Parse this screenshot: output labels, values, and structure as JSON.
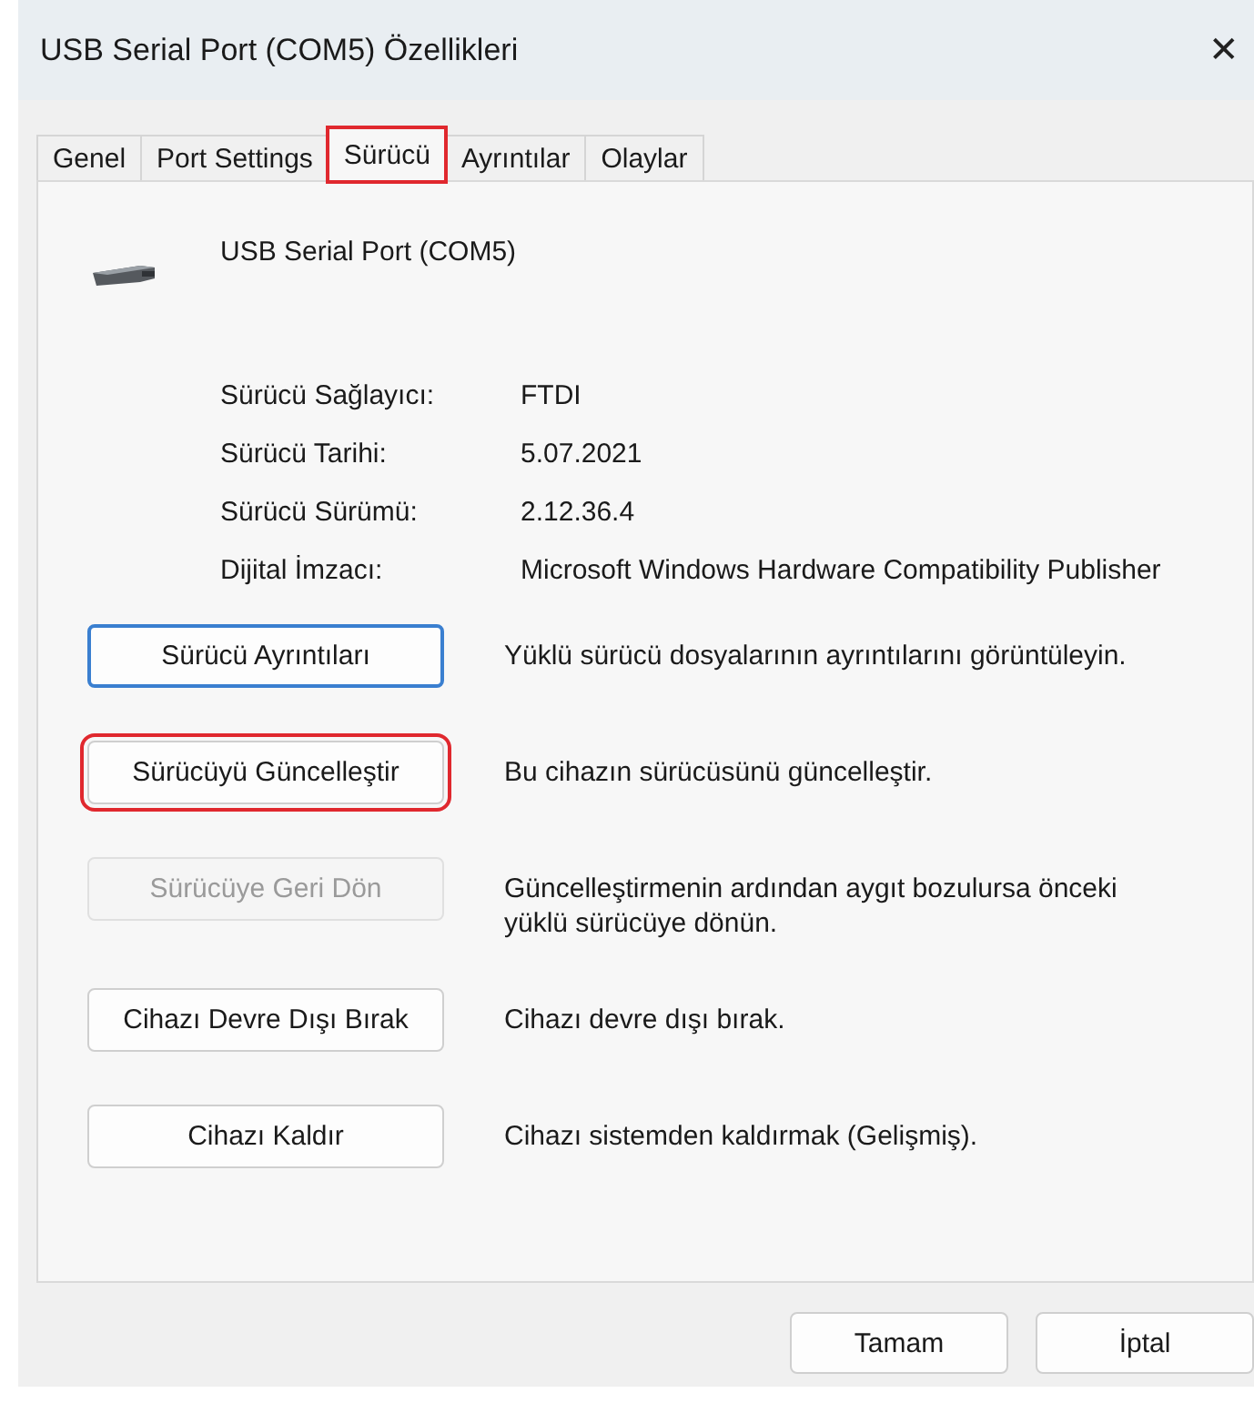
{
  "window": {
    "title": "USB Serial Port (COM5) Özellikleri",
    "close": "✕"
  },
  "tabs": [
    {
      "label": "Genel",
      "selected": false,
      "highlighted": false
    },
    {
      "label": "Port Settings",
      "selected": false,
      "highlighted": false
    },
    {
      "label": "Sürücü",
      "selected": true,
      "highlighted": true
    },
    {
      "label": "Ayrıntılar",
      "selected": false,
      "highlighted": false
    },
    {
      "label": "Olaylar",
      "selected": false,
      "highlighted": false
    }
  ],
  "device": {
    "name": "USB Serial Port (COM5)"
  },
  "info": [
    {
      "label": "Sürücü Sağlayıcı:",
      "value": "FTDI"
    },
    {
      "label": "Sürücü Tarihi:",
      "value": "5.07.2021"
    },
    {
      "label": "Sürücü Sürümü:",
      "value": "2.12.36.4"
    },
    {
      "label": "Dijital İmzacı:",
      "value": "Microsoft Windows Hardware Compatibility Publisher"
    }
  ],
  "actions": [
    {
      "button": "Sürücü Ayrıntıları",
      "description": "Yüklü sürücü dosyalarının ayrıntılarını görüntüleyin.",
      "disabled": false,
      "focused": true,
      "highlighted": false
    },
    {
      "button": "Sürücüyü Güncelleştir",
      "description": "Bu cihazın sürücüsünü güncelleştir.",
      "disabled": false,
      "focused": false,
      "highlighted": true
    },
    {
      "button": "Sürücüye Geri Dön",
      "description": "Güncelleştirmenin ardından aygıt bozulursa önceki yüklü sürücüye dönün.",
      "disabled": true,
      "focused": false,
      "highlighted": false
    },
    {
      "button": "Cihazı Devre Dışı Bırak",
      "description": "Cihazı devre dışı bırak.",
      "disabled": false,
      "focused": false,
      "highlighted": false
    },
    {
      "button": "Cihazı Kaldır",
      "description": "Cihazı sistemden kaldırmak (Gelişmiş).",
      "disabled": false,
      "focused": false,
      "highlighted": false
    }
  ],
  "buttons": [
    "Tamam",
    "İptal"
  ]
}
